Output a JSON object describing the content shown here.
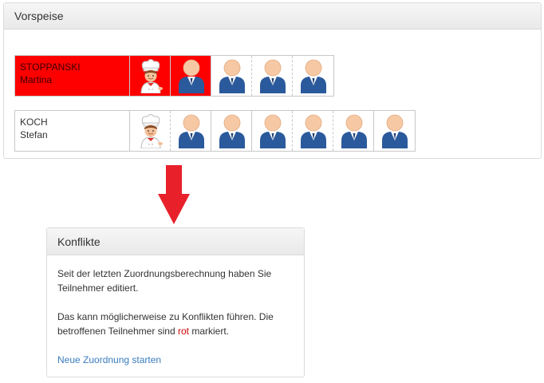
{
  "vorspeise": {
    "title": "Vorspeise",
    "teams": [
      {
        "surname": "STOPPANSKI",
        "firstname": "Martina",
        "highlighted": true,
        "guests": 4
      },
      {
        "surname": "KOCH",
        "firstname": "Stefan",
        "highlighted": false,
        "guests": 6
      }
    ]
  },
  "konflikte": {
    "title": "Konflikte",
    "paragraph1": "Seit der letzten Zuordnungsberechnung haben Sie Teilnehmer editiert.",
    "paragraph2_before": "Das kann möglicherweise zu Konflikten führen. Die betroffenen Teilnehmer sind ",
    "paragraph2_red": "rot",
    "paragraph2_after": " markiert.",
    "link_label": "Neue Zuordnung starten"
  },
  "colors": {
    "conflict_red": "#ff0000",
    "link_blue": "#3a7cbe",
    "arrow_red": "#e8202a"
  },
  "icons": [
    "chef-icon",
    "guest-person-icon",
    "down-arrow-icon"
  ]
}
